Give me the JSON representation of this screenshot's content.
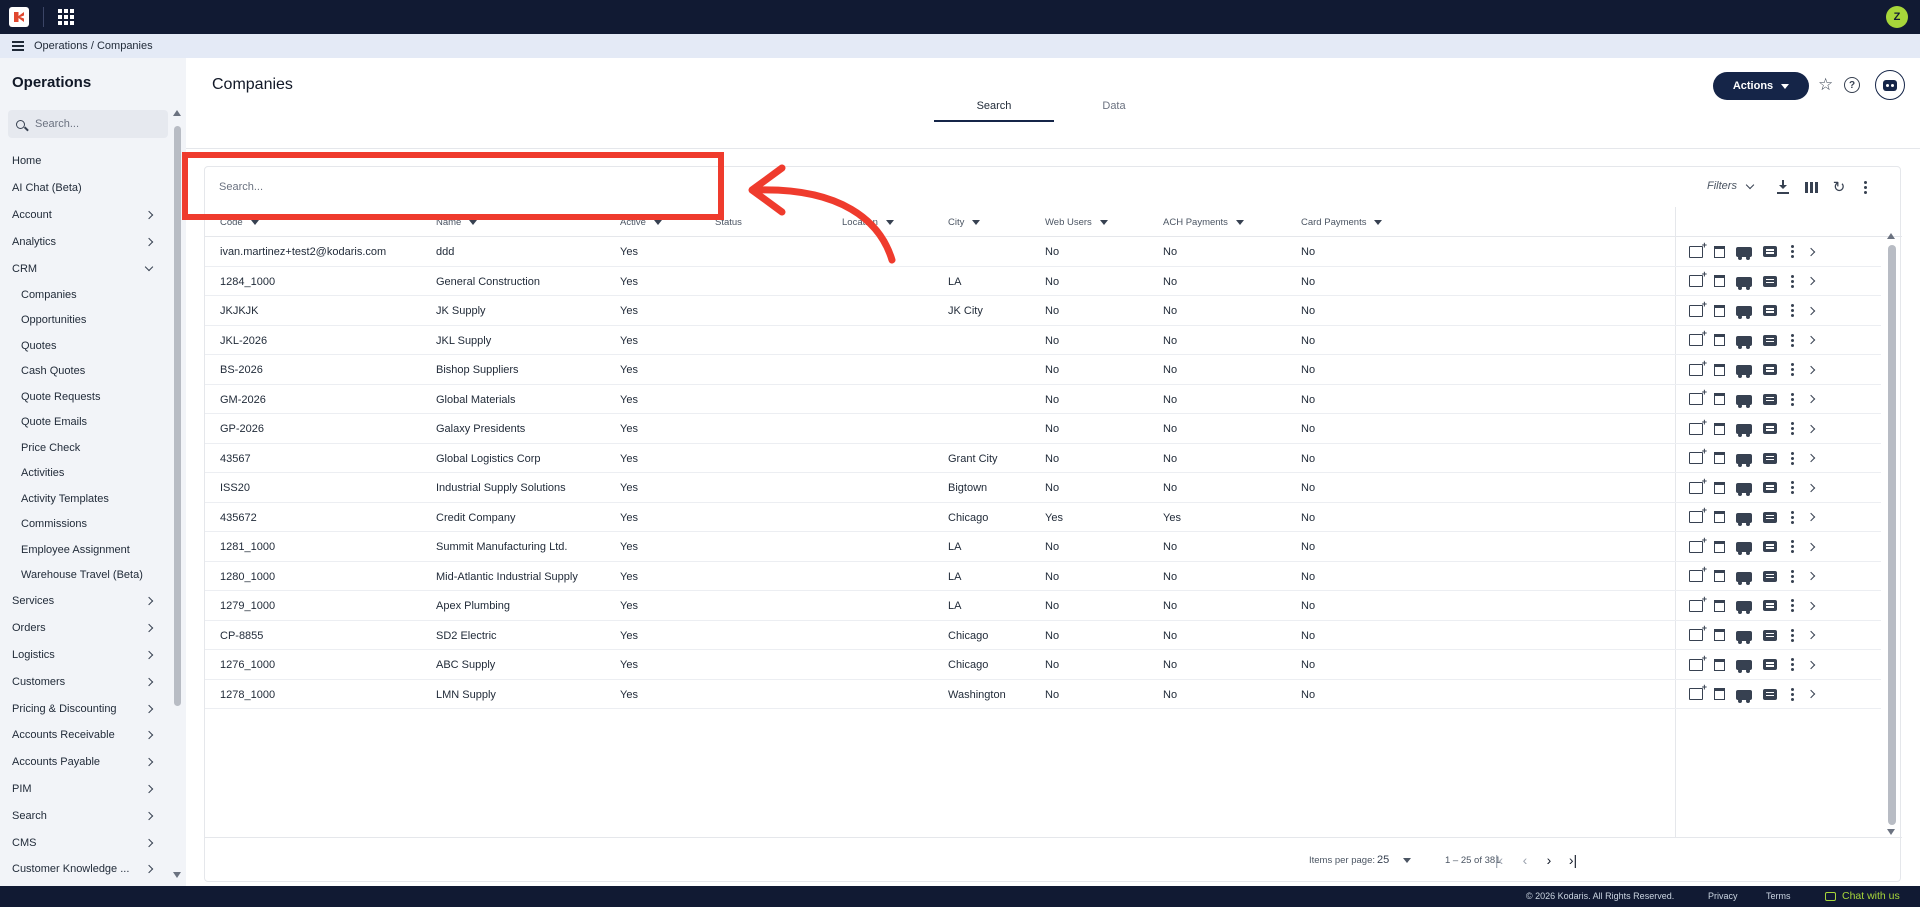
{
  "topbar": {
    "avatar_initial": "Z"
  },
  "breadcrumb": {
    "text": "Operations / Companies"
  },
  "sidebar": {
    "title": "Operations",
    "search_placeholder": "Search...",
    "items": [
      {
        "label": "Home",
        "type": "leaf"
      },
      {
        "label": "AI Chat (Beta)",
        "type": "leaf"
      },
      {
        "label": "Account",
        "type": "collapsed"
      },
      {
        "label": "Analytics",
        "type": "collapsed"
      },
      {
        "label": "CRM",
        "type": "expanded"
      },
      {
        "label": "Companies",
        "type": "sub"
      },
      {
        "label": "Opportunities",
        "type": "sub"
      },
      {
        "label": "Quotes",
        "type": "sub"
      },
      {
        "label": "Cash Quotes",
        "type": "sub"
      },
      {
        "label": "Quote Requests",
        "type": "sub"
      },
      {
        "label": "Quote Emails",
        "type": "sub"
      },
      {
        "label": "Price Check",
        "type": "sub"
      },
      {
        "label": "Activities",
        "type": "sub"
      },
      {
        "label": "Activity Templates",
        "type": "sub"
      },
      {
        "label": "Commissions",
        "type": "sub"
      },
      {
        "label": "Employee Assignment",
        "type": "sub"
      },
      {
        "label": "Warehouse Travel (Beta)",
        "type": "sub"
      },
      {
        "label": "Services",
        "type": "collapsed"
      },
      {
        "label": "Orders",
        "type": "collapsed"
      },
      {
        "label": "Logistics",
        "type": "collapsed"
      },
      {
        "label": "Customers",
        "type": "collapsed"
      },
      {
        "label": "Pricing & Discounting",
        "type": "collapsed"
      },
      {
        "label": "Accounts Receivable",
        "type": "collapsed"
      },
      {
        "label": "Accounts Payable",
        "type": "collapsed"
      },
      {
        "label": "PIM",
        "type": "collapsed"
      },
      {
        "label": "Search",
        "type": "collapsed"
      },
      {
        "label": "CMS",
        "type": "collapsed"
      },
      {
        "label": "Customer Knowledge ...",
        "type": "collapsed"
      }
    ]
  },
  "header": {
    "title": "Companies",
    "actions_label": "Actions",
    "star_icon": "star-outline-icon",
    "help_icon": "help-circle-icon",
    "bot_icon": "assistant-bot-icon"
  },
  "tabs": [
    {
      "label": "Search",
      "active": true
    },
    {
      "label": "Data",
      "active": false
    }
  ],
  "grid": {
    "search_placeholder": "Search...",
    "filters_label": "Filters",
    "columns": [
      "Code",
      "Name",
      "Active",
      "Status",
      "Location",
      "City",
      "Web Users",
      "ACH Payments",
      "Card Payments"
    ],
    "sortable": [
      true,
      true,
      true,
      false,
      true,
      true,
      true,
      true,
      true
    ],
    "rows": [
      [
        "ivan.martinez+test2@kodaris.com",
        "ddd",
        "Yes",
        "",
        "",
        "",
        "No",
        "No",
        "No"
      ],
      [
        "1284_1000",
        "General Construction",
        "Yes",
        "",
        "",
        "LA",
        "No",
        "No",
        "No"
      ],
      [
        "JKJKJK",
        "JK Supply",
        "Yes",
        "",
        "",
        "JK City",
        "No",
        "No",
        "No"
      ],
      [
        "JKL-2026",
        "JKL Supply",
        "Yes",
        "",
        "",
        "",
        "No",
        "No",
        "No"
      ],
      [
        "BS-2026",
        "Bishop Suppliers",
        "Yes",
        "",
        "",
        "",
        "No",
        "No",
        "No"
      ],
      [
        "GM-2026",
        "Global Materials",
        "Yes",
        "",
        "",
        "",
        "No",
        "No",
        "No"
      ],
      [
        "GP-2026",
        "Galaxy Presidents",
        "Yes",
        "",
        "",
        "",
        "No",
        "No",
        "No"
      ],
      [
        "43567",
        "Global Logistics Corp",
        "Yes",
        "",
        "",
        "Grant City",
        "No",
        "No",
        "No"
      ],
      [
        "ISS20",
        "Industrial Supply Solutions",
        "Yes",
        "",
        "",
        "Bigtown",
        "No",
        "No",
        "No"
      ],
      [
        "435672",
        "Credit Company",
        "Yes",
        "",
        "",
        "Chicago",
        "Yes",
        "Yes",
        "No"
      ],
      [
        "1281_1000",
        "Summit Manufacturing Ltd.",
        "Yes",
        "",
        "",
        "LA",
        "No",
        "No",
        "No"
      ],
      [
        "1280_1000",
        "Mid-Atlantic Industrial Supply",
        "Yes",
        "",
        "",
        "LA",
        "No",
        "No",
        "No"
      ],
      [
        "1279_1000",
        "Apex Plumbing",
        "Yes",
        "",
        "",
        "LA",
        "No",
        "No",
        "No"
      ],
      [
        "CP-8855",
        "SD2 Electric",
        "Yes",
        "",
        "",
        "Chicago",
        "No",
        "No",
        "No"
      ],
      [
        "1276_1000",
        "ABC Supply",
        "Yes",
        "",
        "",
        "Chicago",
        "No",
        "No",
        "No"
      ],
      [
        "1278_1000",
        "LMN Supply",
        "Yes",
        "",
        "",
        "Washington",
        "No",
        "No",
        "No"
      ]
    ],
    "row_action_icons": [
      "add-document-icon",
      "clipboard-icon",
      "truck-icon",
      "comment-icon",
      "more-vert-icon",
      "chevron-right-icon"
    ]
  },
  "pager": {
    "items_per_page_label": "Items per page:",
    "page_size": "25",
    "range": "1 – 25 of 381"
  },
  "footer": {
    "copyright": "© 2026 Kodaris. All Rights Reserved.",
    "privacy": "Privacy",
    "terms": "Terms",
    "chat": "Chat with us"
  },
  "annotation": {
    "color": "#ef3b2d"
  },
  "colors": {
    "navy": "#111a33",
    "accent": "#a7d63a",
    "primary_button": "#152548"
  }
}
